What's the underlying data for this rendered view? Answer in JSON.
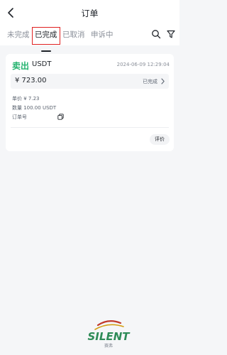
{
  "header": {
    "title": "订单"
  },
  "tabs": [
    {
      "label": "未完成",
      "active": false
    },
    {
      "label": "已完成",
      "active": true
    },
    {
      "label": "已取消",
      "active": false
    },
    {
      "label": "申诉中",
      "active": false
    }
  ],
  "toolbar": {
    "search_icon": "search-icon",
    "filter_icon": "filter-icon"
  },
  "order": {
    "side": "卖出",
    "coin": "USDT",
    "datetime": "2024-06-09 12:29:04",
    "amount": "¥ 723.00",
    "status": "已完成",
    "price_line": "单价 ¥ 7.23",
    "quantity_line": "数量 100.00 USDT",
    "order_no_label": "订单号",
    "rate_button": "评价"
  },
  "watermark": {
    "text": "SILENT",
    "subtext": "赛弗"
  },
  "colors": {
    "sell": "#23b36e",
    "highlight_box": "#e02020",
    "background": "#f5f6f8"
  }
}
